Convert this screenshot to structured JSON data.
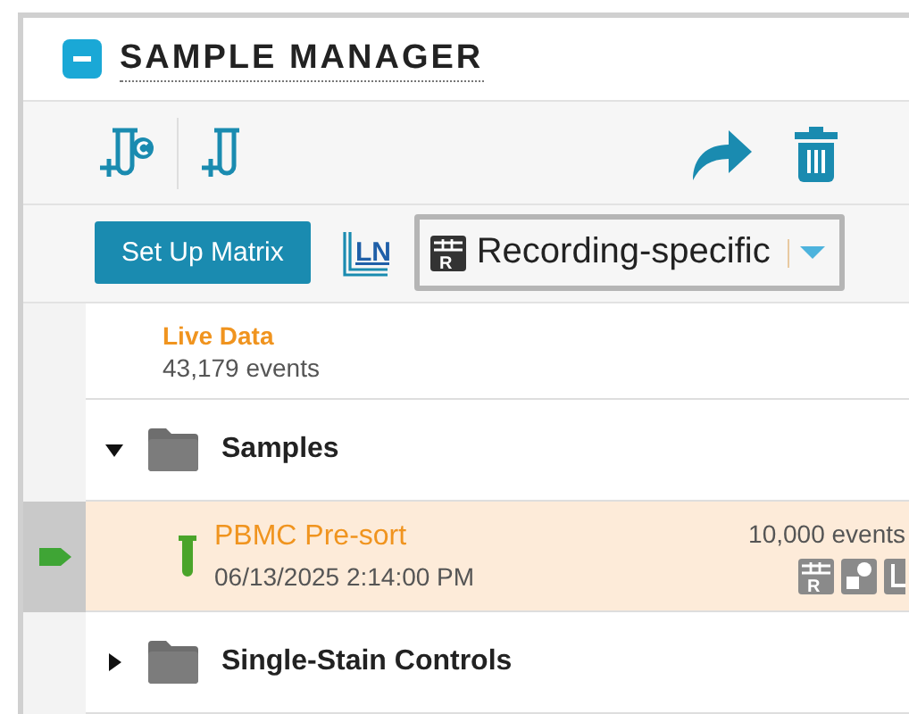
{
  "panel": {
    "title": "SAMPLE MANAGER",
    "expanded": true
  },
  "matrix_button": {
    "label": "Set Up Matrix"
  },
  "layout_icon": {
    "text": "LN"
  },
  "layout_dropdown": {
    "icon_letter": "R",
    "value": "Recording-specific"
  },
  "live_data": {
    "title": "Live Data",
    "count": "43,179 events"
  },
  "tree": [
    {
      "kind": "folder",
      "label": "Samples",
      "expanded": true,
      "children": [
        {
          "kind": "sample",
          "name": "PBMC Pre-sort",
          "date": "06/13/2025 2:14:00 PM",
          "events": "10,000 events",
          "icon_letter": "R",
          "selected": true,
          "current": true
        }
      ]
    },
    {
      "kind": "folder",
      "label": "Single-Stain Controls",
      "expanded": false
    }
  ]
}
